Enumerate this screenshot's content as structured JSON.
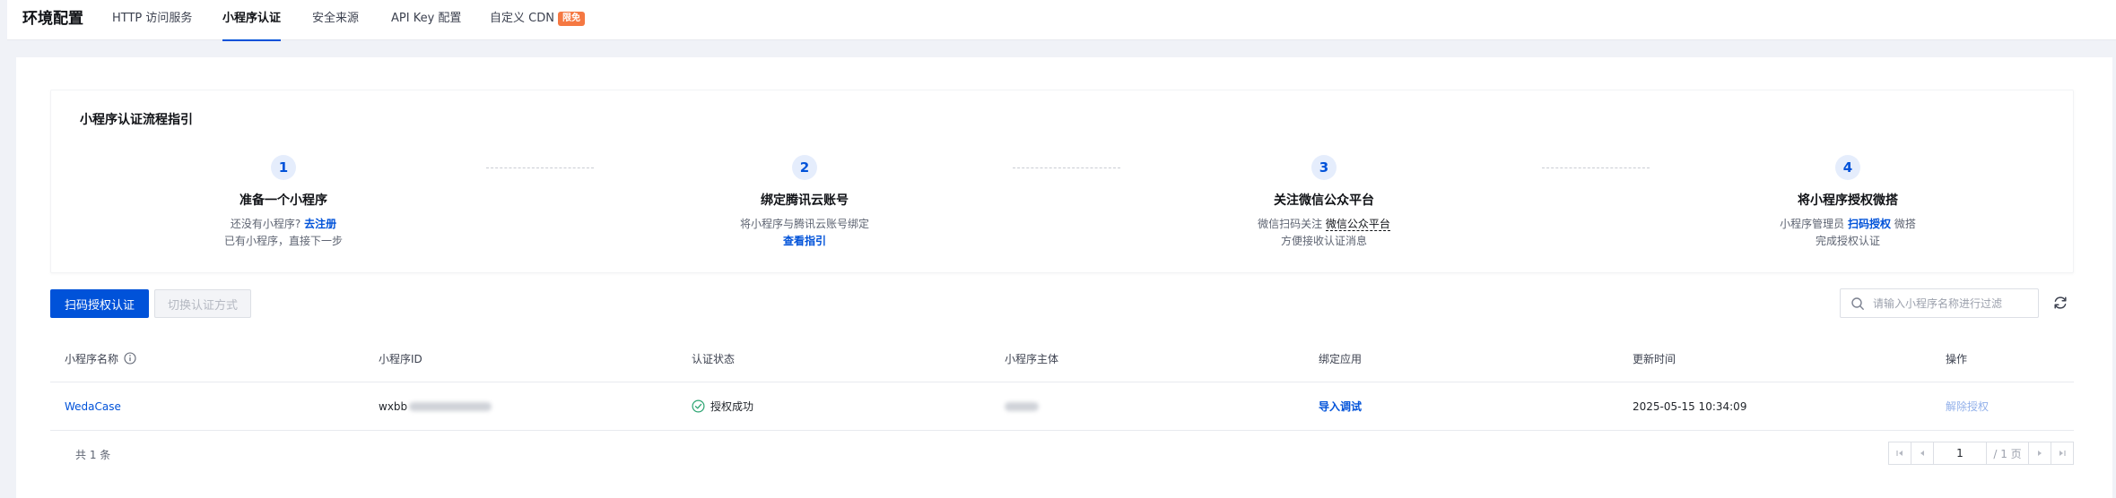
{
  "header": {
    "title": "环境配置",
    "tabs": [
      {
        "label": "HTTP 访问服务"
      },
      {
        "label": "小程序认证"
      },
      {
        "label": "安全来源"
      },
      {
        "label": "API Key 配置"
      },
      {
        "label": "自定义 CDN",
        "badge": "限免"
      }
    ],
    "active_tab": "小程序认证"
  },
  "guide": {
    "title": "小程序认证流程指引",
    "steps": [
      {
        "num": "1",
        "title": "准备一个小程序",
        "line1_text": "还没有小程序?",
        "line1_link": "去注册",
        "line2": "已有小程序，直接下一步"
      },
      {
        "num": "2",
        "title": "绑定腾讯云账号",
        "line1_text": "将小程序与腾讯云账号绑定",
        "line2_link": "查看指引"
      },
      {
        "num": "3",
        "title": "关注微信公众平台",
        "line1_text": "微信扫码关注",
        "line1_link": "微信公众平台",
        "line2": "方便接收认证消息"
      },
      {
        "num": "4",
        "title": "将小程序授权微搭",
        "line1_text": "小程序管理员",
        "line1_link": "扫码授权",
        "line1_suffix": "微搭",
        "line2": "完成授权认证"
      }
    ]
  },
  "toolbar": {
    "primary_label": "扫码授权认证",
    "secondary_label": "切换认证方式",
    "search_placeholder": "请输入小程序名称进行过滤"
  },
  "table": {
    "columns": [
      "小程序名称",
      "小程序ID",
      "认证状态",
      "小程序主体",
      "绑定应用",
      "更新时间",
      "操作"
    ],
    "rows": [
      {
        "name": "WedaCase",
        "id_prefix": "wxbb",
        "status": "授权成功",
        "app_link": "导入调试",
        "updated": "2025-05-15 10:34:09",
        "action": "解除授权"
      }
    ],
    "total_text": "共 1 条"
  },
  "pagination": {
    "current_page": "1",
    "total_pages_text": "/ 1 页"
  },
  "colors": {
    "primary": "#0052d9",
    "badge": "#f57842",
    "success": "#2ba471"
  }
}
